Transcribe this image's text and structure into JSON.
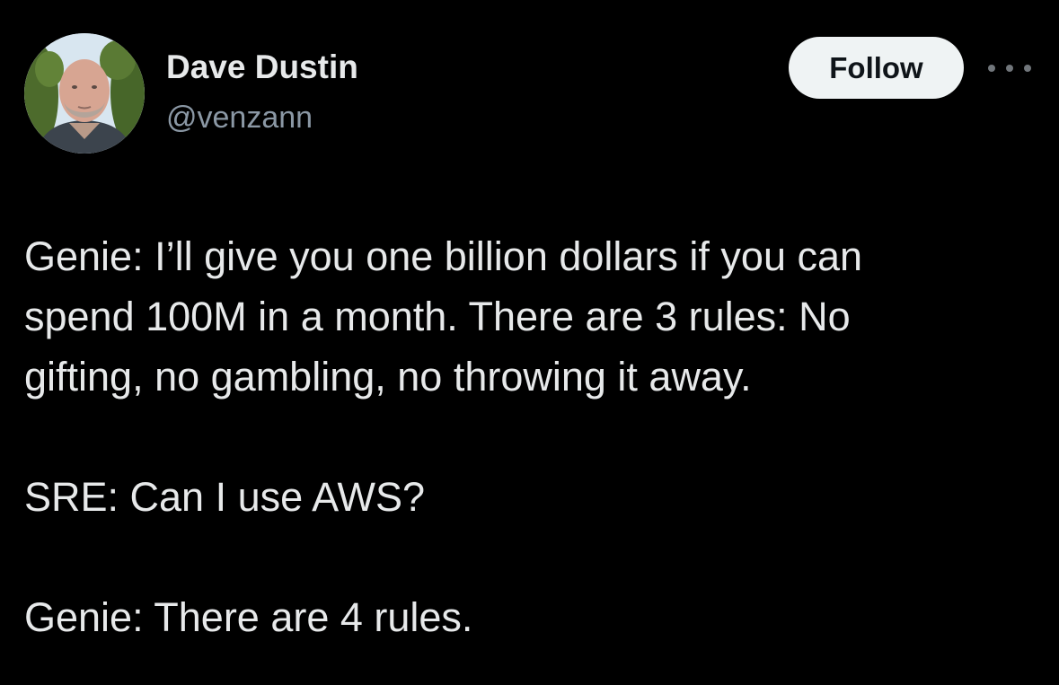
{
  "author": {
    "display_name": "Dave Dustin",
    "handle": "@venzann"
  },
  "actions": {
    "follow_label": "Follow",
    "more_icon": "more-horizontal-icon"
  },
  "tweet": {
    "lines": [
      "Genie: I’ll give you one billion dollars if you can",
      "spend 100M in a month. There are 3 rules: No",
      "gifting, no gambling, no throwing it away.",
      "SRE: Can I use AWS?",
      "Genie: There are 4 rules."
    ]
  },
  "colors": {
    "background": "#000000",
    "primary_text": "#e7e9ea",
    "secondary_text": "#8b98a5",
    "follow_button_bg": "#eff3f4",
    "follow_button_text": "#0f1419"
  }
}
